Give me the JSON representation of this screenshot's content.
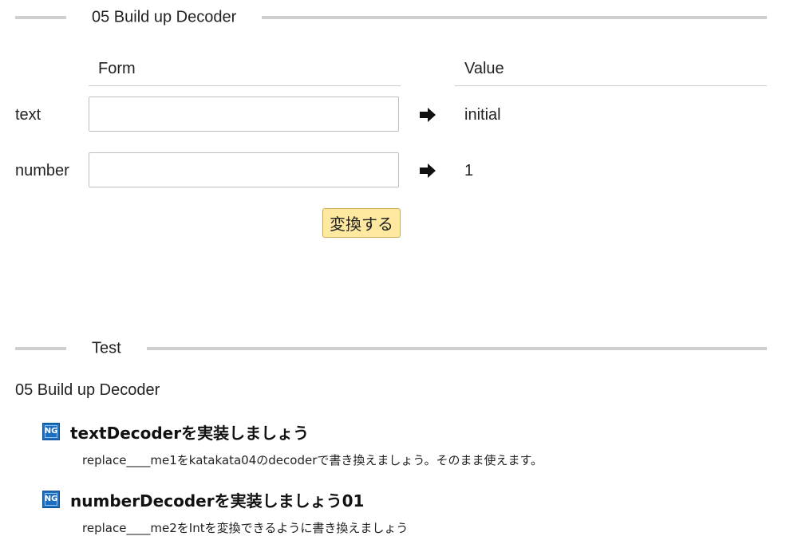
{
  "section_form": {
    "title": "05 Build up Decoder"
  },
  "form": {
    "col_form": "Form",
    "col_value": "Value",
    "rows": [
      {
        "label": "text",
        "input_value": "",
        "value": "initial"
      },
      {
        "label": "number",
        "input_value": "",
        "value": "1"
      }
    ],
    "convert_label": "変換する",
    "arrow_icon": "right-arrow-icon"
  },
  "section_test": {
    "title": "Test"
  },
  "test": {
    "suite_name": "05 Build up Decoder",
    "cases": [
      {
        "badge": "NG",
        "title": "textDecoderを実装しましょう",
        "description": "replace____me1をkatakata04のdecoderで書き換えましょう。そのまま使えます。"
      },
      {
        "badge": "NG",
        "title": "numberDecoderを実装しましょう01",
        "description": "replace____me2をIntを変換できるように書き換えましょう"
      }
    ]
  },
  "colors": {
    "rule": "#cfcfcf",
    "button_bg": "#ffe8a0",
    "badge_bg": "#1a6fc4"
  }
}
